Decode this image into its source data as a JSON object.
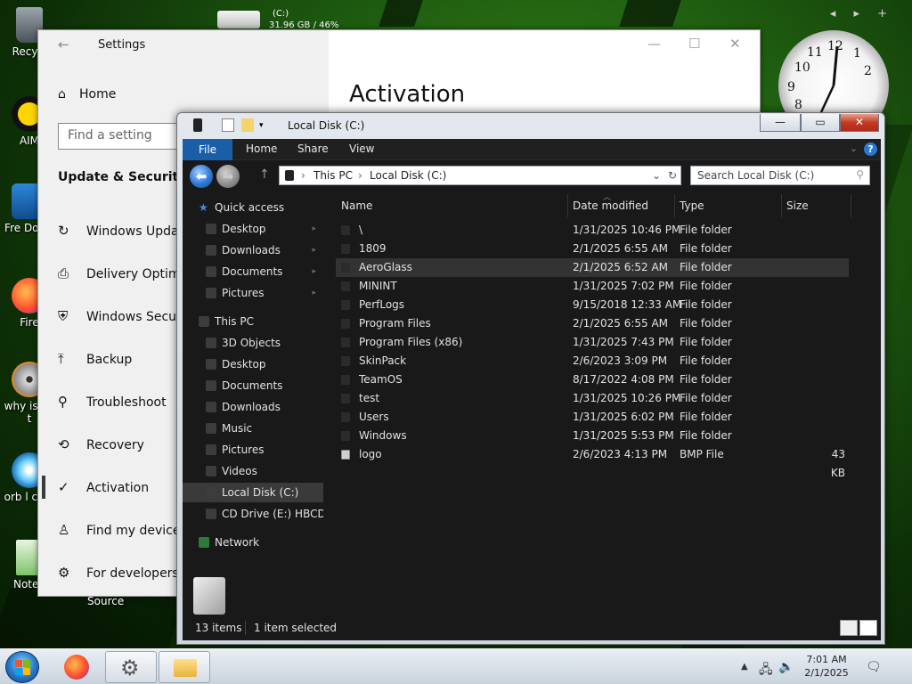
{
  "desktop": {
    "icons": [
      {
        "label": "Recycl"
      },
      {
        "label": "AIM"
      },
      {
        "label": "Fre Down"
      },
      {
        "label": "Fire"
      },
      {
        "label": "why is on t"
      },
      {
        "label": "orb l cum"
      },
      {
        "label": "Notep"
      }
    ],
    "source_label": "Source",
    "top_nav_arrows": "◂ ▸ +"
  },
  "disk_widget": {
    "drive": "(C:)",
    "usage": "31.96 GB / 46%"
  },
  "clock_gadget": {
    "numbers": [
      "12",
      "1",
      "2",
      "10",
      "11",
      "9",
      "8"
    ]
  },
  "settings": {
    "title": "Settings",
    "back_glyph": "←",
    "minimize_glyph": "—",
    "maximize_glyph": "☐",
    "close_glyph": "✕",
    "home": "Home",
    "find_placeholder": "Find a setting",
    "section": "Update & Security",
    "nav": [
      {
        "label": "Windows Update",
        "icon": "↻"
      },
      {
        "label": "Delivery Optimiz",
        "icon": "⎙"
      },
      {
        "label": "Windows Securit",
        "icon": "⛨"
      },
      {
        "label": "Backup",
        "icon": "⤒"
      },
      {
        "label": "Troubleshoot",
        "icon": "⚲"
      },
      {
        "label": "Recovery",
        "icon": "⟲"
      },
      {
        "label": "Activation",
        "icon": "✓"
      },
      {
        "label": "Find my device",
        "icon": "♙"
      },
      {
        "label": "For developers",
        "icon": "⚙"
      }
    ],
    "heading": "Activation"
  },
  "explorer": {
    "title": "Local Disk (C:)",
    "window_controls": {
      "minimize": "—",
      "maximize": "▭",
      "close": "✕"
    },
    "ribbon_tabs": [
      "File",
      "Home",
      "Share",
      "View"
    ],
    "help": "?",
    "address": {
      "crumbs": [
        "This PC",
        "Local Disk (C:)"
      ],
      "sep": "›"
    },
    "search_placeholder": "Search Local Disk (C:)",
    "nav_pane": [
      {
        "label": "Quick access",
        "level": 0,
        "pin": false
      },
      {
        "label": "Desktop",
        "level": 1,
        "pin": true
      },
      {
        "label": "Downloads",
        "level": 1,
        "pin": true
      },
      {
        "label": "Documents",
        "level": 1,
        "pin": true
      },
      {
        "label": "Pictures",
        "level": 1,
        "pin": true
      },
      {
        "label": "This PC",
        "level": 0,
        "pin": false
      },
      {
        "label": "3D Objects",
        "level": 1,
        "pin": false
      },
      {
        "label": "Desktop",
        "level": 1,
        "pin": false
      },
      {
        "label": "Documents",
        "level": 1,
        "pin": false
      },
      {
        "label": "Downloads",
        "level": 1,
        "pin": false
      },
      {
        "label": "Music",
        "level": 1,
        "pin": false
      },
      {
        "label": "Pictures",
        "level": 1,
        "pin": false
      },
      {
        "label": "Videos",
        "level": 1,
        "pin": false
      },
      {
        "label": "Local Disk (C:)",
        "level": 1,
        "pin": false,
        "selected": true
      },
      {
        "label": "CD Drive (E:) HBCD_",
        "level": 1,
        "pin": false
      },
      {
        "label": "Network",
        "level": 0,
        "pin": false
      }
    ],
    "columns": {
      "name": "Name",
      "date": "Date modified",
      "type": "Type",
      "size": "Size"
    },
    "files": [
      {
        "name": "\\",
        "date": "1/31/2025 10:46 PM",
        "type": "File folder",
        "size": ""
      },
      {
        "name": "1809",
        "date": "2/1/2025 6:55 AM",
        "type": "File folder",
        "size": ""
      },
      {
        "name": "AeroGlass",
        "date": "2/1/2025 6:52 AM",
        "type": "File folder",
        "size": "",
        "selected": true
      },
      {
        "name": "MININT",
        "date": "1/31/2025 7:02 PM",
        "type": "File folder",
        "size": ""
      },
      {
        "name": "PerfLogs",
        "date": "9/15/2018 12:33 AM",
        "type": "File folder",
        "size": ""
      },
      {
        "name": "Program Files",
        "date": "2/1/2025 6:55 AM",
        "type": "File folder",
        "size": ""
      },
      {
        "name": "Program Files (x86)",
        "date": "1/31/2025 7:43 PM",
        "type": "File folder",
        "size": ""
      },
      {
        "name": "SkinPack",
        "date": "2/6/2023 3:09 PM",
        "type": "File folder",
        "size": ""
      },
      {
        "name": "TeamOS",
        "date": "8/17/2022 4:08 PM",
        "type": "File folder",
        "size": ""
      },
      {
        "name": "test",
        "date": "1/31/2025 10:26 PM",
        "type": "File folder",
        "size": ""
      },
      {
        "name": "Users",
        "date": "1/31/2025 6:02 PM",
        "type": "File folder",
        "size": ""
      },
      {
        "name": "Windows",
        "date": "1/31/2025 5:53 PM",
        "type": "File folder",
        "size": ""
      },
      {
        "name": "logo",
        "date": "2/6/2023 4:13 PM",
        "type": "BMP File",
        "size": "43 KB",
        "is_file": true
      }
    ],
    "status": {
      "count": "13 items",
      "selected": "1 item selected"
    }
  },
  "taskbar": {
    "time": "7:01 AM",
    "date": "2/1/2025",
    "tray_icons": [
      "▲",
      "🖧",
      "🔈",
      "🗨"
    ]
  },
  "colors": {
    "accent_blue": "#1b5ea8",
    "explorer_bg": "#191919",
    "selection": "#3a3a3a"
  }
}
